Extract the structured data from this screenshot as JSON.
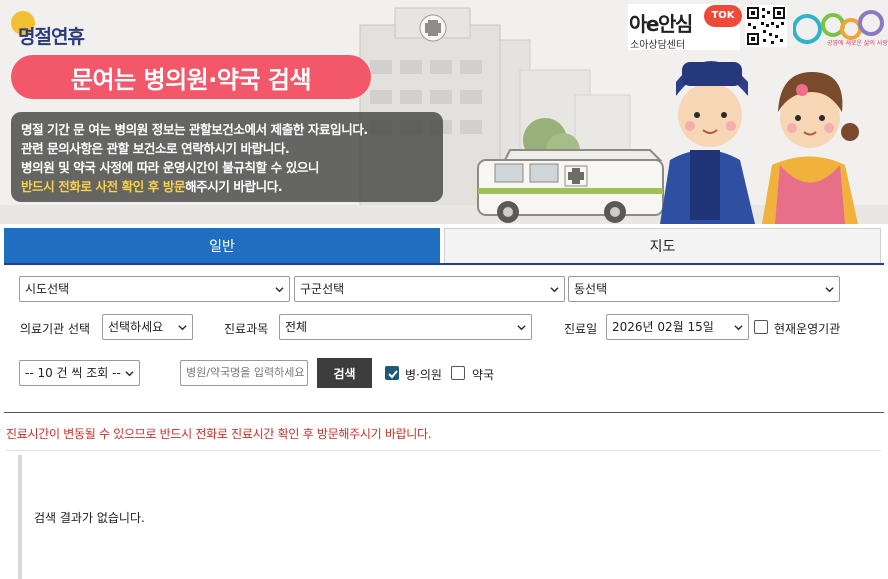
{
  "banner": {
    "holiday_label": "명절연휴",
    "title": "문여는 병의원·약국 검색",
    "notice_lines": [
      "명절 기간 문 여는 병의원 정보는 관할보건소에서 제출한 자료입니다.",
      "관련 문의사항은 관할 보건소로 연락하시기 바랍니다.",
      "병의원 및 약국 사정에 따라 운영시간이 불규칙할 수 있으니"
    ],
    "notice_highlight": "반드시 전화로 사전 확인 후 방문",
    "notice_tail": "해주시기 바랍니다."
  },
  "partner": {
    "name": "아e안심",
    "badge": "TOK",
    "sub": "소아상담센터",
    "gcn_tagline": "공영에 새로운 삶의 사랑"
  },
  "tabs": [
    "일반",
    "지도"
  ],
  "filters": {
    "sido": "시도선택",
    "gugun": "구군선택",
    "dong": "동선택",
    "institution_label": "의료기관 선택",
    "institution_value": "선택하세요",
    "dept_label": "진료과목",
    "dept_value": "전체",
    "date_label": "진료일",
    "date_value": "2026년 02월 15일",
    "open_now_label": "현재운영기관",
    "page_size": "-- 10 건 씩 조회 --",
    "name_placeholder": "병원/약국명을 입력하세요",
    "search_label": "검색",
    "hospital_label": "병·의원",
    "pharmacy_label": "약국"
  },
  "colors": {
    "accent": "#1f6ec2",
    "title_pill": "#f2576a",
    "warning": "#c8302a"
  },
  "warning_text": "진료시간이 변동될 수 있으므로 반드시 전화로 진료시간 확인 후 방문해주시기 바랍니다.",
  "result_message": "검색 결과가 없습니다."
}
